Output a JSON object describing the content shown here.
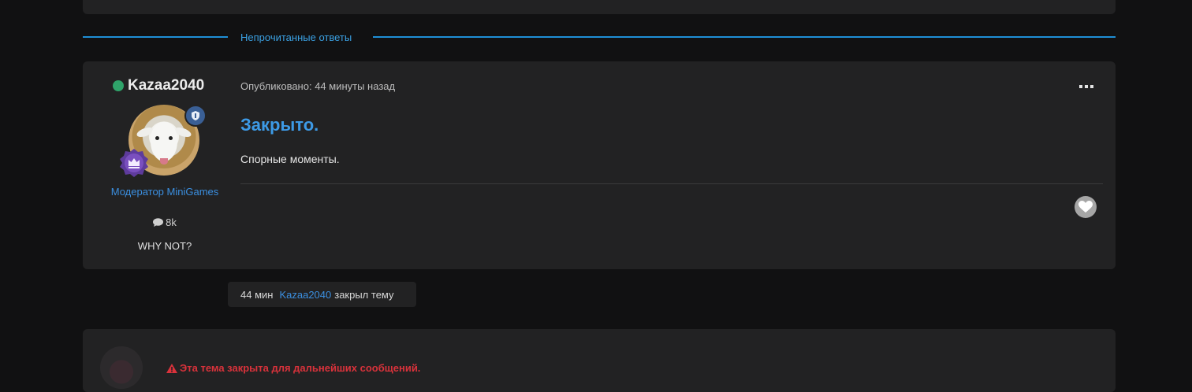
{
  "unread_separator": {
    "label": "Непрочитанные ответы"
  },
  "post": {
    "author": {
      "name": "Kazaa2040",
      "role": "Модератор MiniGames",
      "posts_count": "8k",
      "motto": "WHY NOT?",
      "online": true
    },
    "published": "Опубликовано: 44 минуты назад",
    "title": "Закрыто.",
    "text": "Спорные моменты.",
    "menu_icon": "more-horizontal-icon",
    "like_icon": "heart-icon"
  },
  "event": {
    "time": "44 мин",
    "user": "Kazaa2040",
    "action": "закрыл тему"
  },
  "locked_notice": {
    "text": "Эта тема закрыта для дальнейших сообщений.",
    "icon": "warning-icon"
  },
  "colors": {
    "accent": "#3b8fe0",
    "online": "#2fa36a",
    "danger": "#d9323b"
  }
}
